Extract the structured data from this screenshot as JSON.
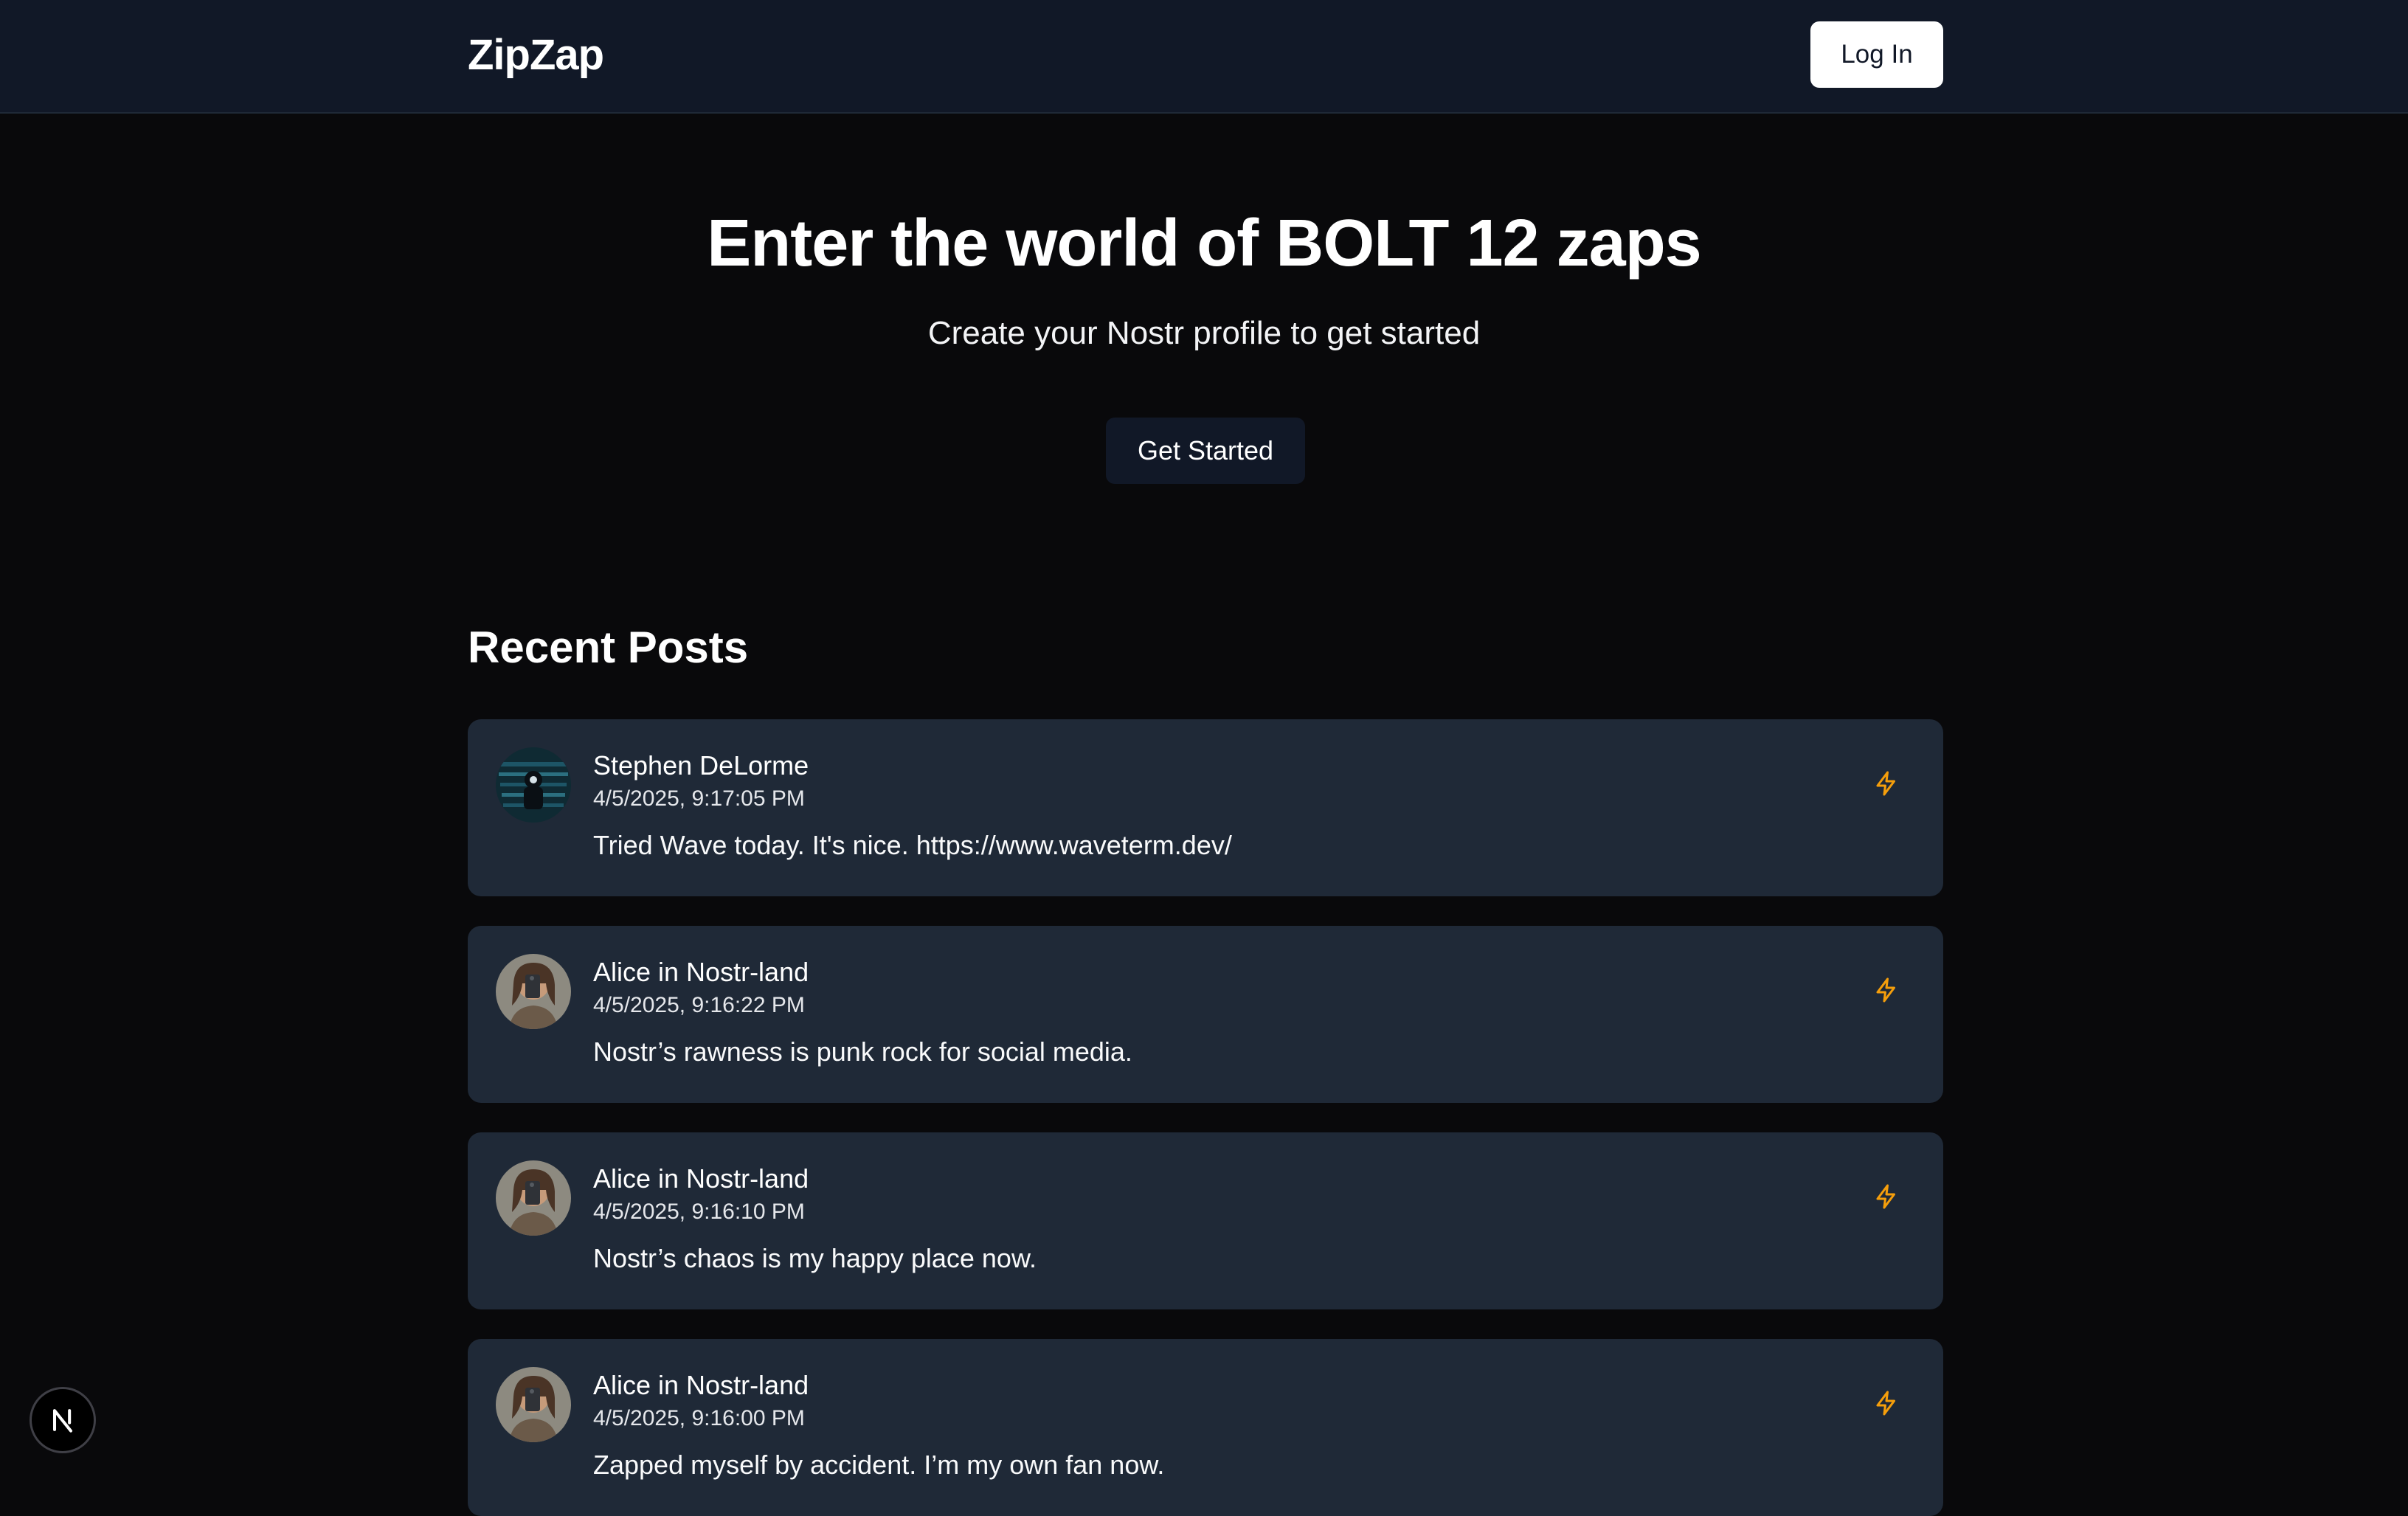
{
  "header": {
    "brand": "ZipZap",
    "login_label": "Log In"
  },
  "hero": {
    "title": "Enter the world of BOLT 12 zaps",
    "subtitle": "Create your Nostr profile to get started",
    "cta_label": "Get Started"
  },
  "recent_posts": {
    "title": "Recent Posts",
    "posts": [
      {
        "author": "Stephen DeLorme",
        "timestamp": "4/5/2025, 9:17:05 PM",
        "content": "Tried Wave today. It's nice. https://www.waveterm.dev/"
      },
      {
        "author": "Alice in Nostr-land",
        "timestamp": "4/5/2025, 9:16:22 PM",
        "content": "Nostr’s rawness is punk rock for social media."
      },
      {
        "author": "Alice in Nostr-land",
        "timestamp": "4/5/2025, 9:16:10 PM",
        "content": "Nostr’s chaos is my happy place now."
      },
      {
        "author": "Alice in Nostr-land",
        "timestamp": "4/5/2025, 9:16:00 PM",
        "content": "Zapped myself by accident. I’m my own fan now."
      }
    ]
  },
  "colors": {
    "zap_icon": "#f59e0b",
    "card_bg": "#1f2937",
    "navbar_bg": "#111827",
    "page_bg": "#09090b"
  },
  "icons": {
    "zap": "lightning-bolt-icon",
    "next_badge": "nextjs-logo-icon"
  }
}
